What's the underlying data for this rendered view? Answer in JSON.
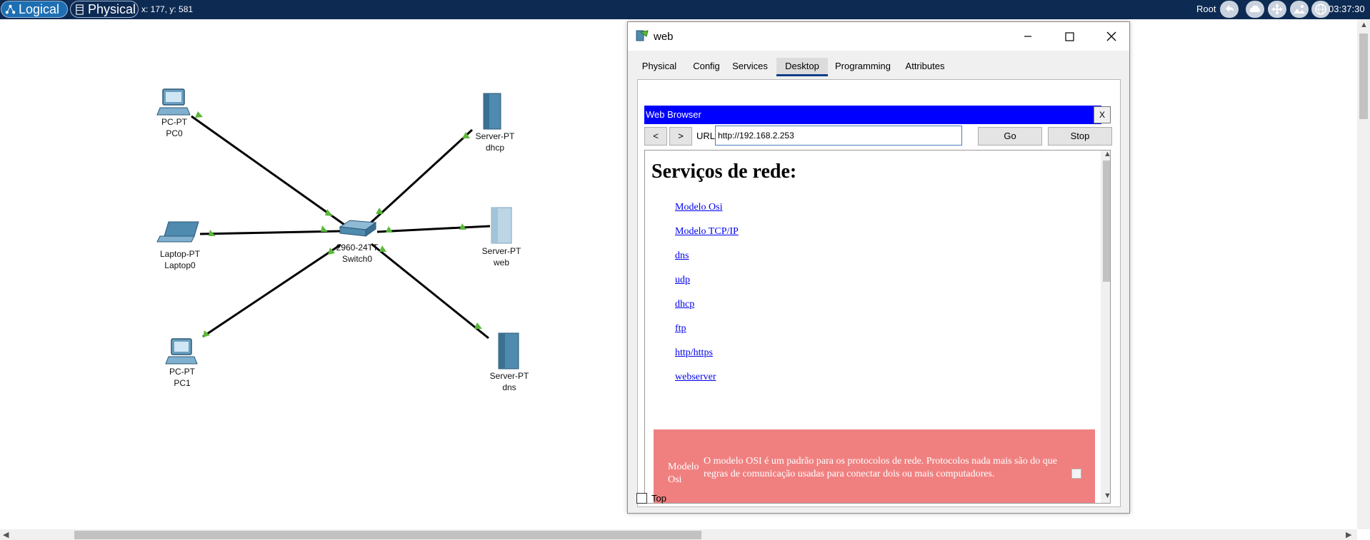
{
  "topbar": {
    "logical_label": "Logical",
    "physical_label": "Physical",
    "coords": "x: 177, y: 581",
    "root_label": "Root",
    "clock": "03:37:30",
    "icons": [
      "back-icon",
      "cloud-icon",
      "move-icon",
      "image-icon",
      "globe-icon"
    ]
  },
  "topology": {
    "devices": [
      {
        "type": "PC-PT",
        "name": "PC0"
      },
      {
        "type": "Laptop-PT",
        "name": "Laptop0"
      },
      {
        "type": "PC-PT",
        "name": "PC1"
      },
      {
        "type": "2960-24TT",
        "name": "Switch0"
      },
      {
        "type": "Server-PT",
        "name": "dhcp"
      },
      {
        "type": "Server-PT",
        "name": "web"
      },
      {
        "type": "Server-PT",
        "name": "dns"
      }
    ],
    "link_color": "#000000",
    "link_status_color": "#5cb83a"
  },
  "window": {
    "title": "web",
    "tabs": [
      "Physical",
      "Config",
      "Services",
      "Desktop",
      "Programming",
      "Attributes"
    ],
    "active_tab": "Desktop",
    "browser": {
      "title": "Web Browser",
      "close_label": "X",
      "back_label": "<",
      "forward_label": ">",
      "url_label": "URL",
      "url_value": "http://192.168.2.253",
      "go_label": "Go",
      "stop_label": "Stop"
    },
    "page": {
      "heading": "Serviços de rede:",
      "links": [
        "Modelo Osi",
        "Modelo TCP/IP",
        "dns",
        "udp",
        "dhcp",
        "ftp",
        "http/https",
        "webserver"
      ],
      "osi_title": "Modelo Osi",
      "osi_text": "O modelo OSI é um padrão para os protocolos de rede. Protocolos nada mais são do que regras de comunicação usadas para conectar dois ou mais computadores.",
      "osi_color": "#f08080",
      "next_section_color": "#90ee90"
    },
    "top_checkbox_label": "Top"
  }
}
